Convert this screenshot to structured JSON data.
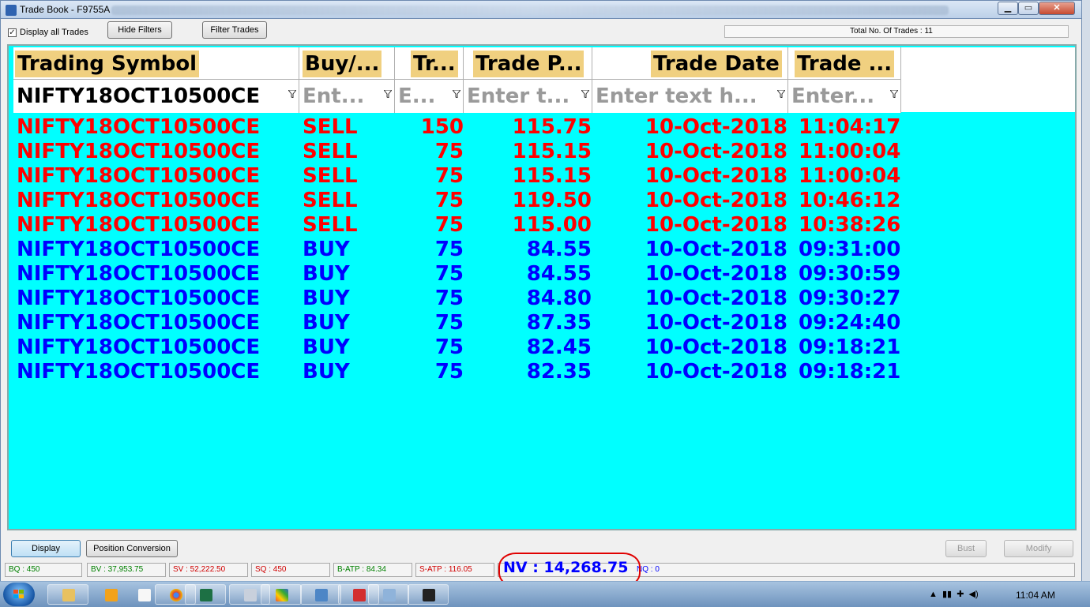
{
  "window": {
    "title": "Trade Book - F9755A",
    "min_glyph": "▁",
    "max_glyph": "▭",
    "close_glyph": "✕"
  },
  "toolbar": {
    "display_all_label": "Display all Trades",
    "display_all_checked": "✓",
    "hide_filters_label": "Hide Filters",
    "filter_trades_label": "Filter Trades",
    "total_trades_text": "Total No. Of Trades : 11"
  },
  "grid": {
    "headers": [
      "Trading Symbol",
      "Buy/...",
      "Tr...",
      "Trade P...",
      "Trade Date",
      "Trade ..."
    ],
    "filters": {
      "symbol_value": "NIFTY18OCT10500CE",
      "buy_placeholder": "Ent...",
      "qty_placeholder": "E...",
      "price_placeholder": "Enter t...",
      "date_placeholder": "Enter text h...",
      "time_placeholder": "Enter..."
    },
    "rows": [
      {
        "symbol": "NIFTY18OCT10500CE",
        "side": "SELL",
        "qty": "150",
        "price": "115.75",
        "date": "10-Oct-2018",
        "time": "11:04:17"
      },
      {
        "symbol": "NIFTY18OCT10500CE",
        "side": "SELL",
        "qty": "75",
        "price": "115.15",
        "date": "10-Oct-2018",
        "time": "11:00:04"
      },
      {
        "symbol": "NIFTY18OCT10500CE",
        "side": "SELL",
        "qty": "75",
        "price": "115.15",
        "date": "10-Oct-2018",
        "time": "11:00:04"
      },
      {
        "symbol": "NIFTY18OCT10500CE",
        "side": "SELL",
        "qty": "75",
        "price": "119.50",
        "date": "10-Oct-2018",
        "time": "10:46:12"
      },
      {
        "symbol": "NIFTY18OCT10500CE",
        "side": "SELL",
        "qty": "75",
        "price": "115.00",
        "date": "10-Oct-2018",
        "time": "10:38:26"
      },
      {
        "symbol": "NIFTY18OCT10500CE",
        "side": "BUY",
        "qty": "75",
        "price": "84.55",
        "date": "10-Oct-2018",
        "time": "09:31:00"
      },
      {
        "symbol": "NIFTY18OCT10500CE",
        "side": "BUY",
        "qty": "75",
        "price": "84.55",
        "date": "10-Oct-2018",
        "time": "09:30:59"
      },
      {
        "symbol": "NIFTY18OCT10500CE",
        "side": "BUY",
        "qty": "75",
        "price": "84.80",
        "date": "10-Oct-2018",
        "time": "09:30:27"
      },
      {
        "symbol": "NIFTY18OCT10500CE",
        "side": "BUY",
        "qty": "75",
        "price": "87.35",
        "date": "10-Oct-2018",
        "time": "09:24:40"
      },
      {
        "symbol": "NIFTY18OCT10500CE",
        "side": "BUY",
        "qty": "75",
        "price": "82.45",
        "date": "10-Oct-2018",
        "time": "09:18:21"
      },
      {
        "symbol": "NIFTY18OCT10500CE",
        "side": "BUY",
        "qty": "75",
        "price": "82.35",
        "date": "10-Oct-2018",
        "time": "09:18:21"
      }
    ]
  },
  "buttons": {
    "display_label": "Display",
    "position_conversion_label": "Position Conversion",
    "bust_label": "Bust",
    "modify_label": "Modify"
  },
  "status": {
    "bq": "BQ : 450",
    "bv": "BV : 37,953.75",
    "sv": "SV : 52,222.50",
    "sq": "SQ : 450",
    "batp": "B-ATP : 84.34",
    "satp": "S-ATP : 116.05",
    "nv": "NV : 14,268.75",
    "nq": "NQ : 0"
  },
  "colors": {
    "grid_bg": "#00ffff",
    "sell": "#ff0000",
    "buy": "#0000ff",
    "header_highlight": "#f0d080",
    "status_green": "#008000",
    "status_red": "#d00000",
    "annotation": "#e00000"
  },
  "taskbar": {
    "clock": "11:04 AM",
    "icons": [
      "start-orb-icon",
      "explorer-icon",
      "media-icon",
      "document-icon",
      "chrome-icon",
      "excel-icon",
      "calculator-icon",
      "paint-icon",
      "app-icon",
      "pdf-icon",
      "window-icon",
      "chart-app-icon"
    ]
  }
}
